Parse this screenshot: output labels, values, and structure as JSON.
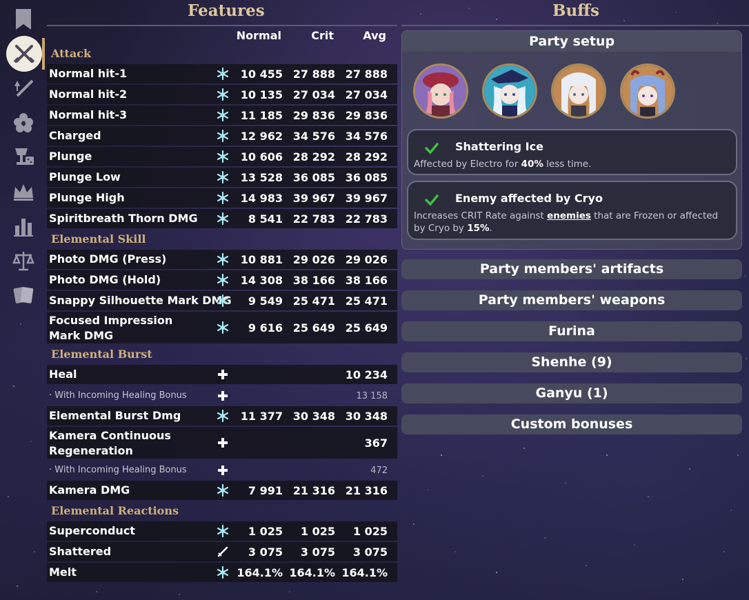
{
  "sidebar": {
    "items": [
      {
        "icon": "bookmark-icon",
        "active": false
      },
      {
        "icon": "crossed-swords-icon",
        "active": true
      },
      {
        "icon": "sword-upgrade-icon",
        "active": false
      },
      {
        "icon": "flower-icon",
        "active": false
      },
      {
        "icon": "goblet-dice-icon",
        "active": false
      },
      {
        "icon": "crown-icon",
        "active": false
      },
      {
        "icon": "bar-chart-icon",
        "active": false
      },
      {
        "icon": "scales-icon",
        "active": false
      },
      {
        "icon": "cards-icon",
        "active": false
      }
    ]
  },
  "features": {
    "title": "Features",
    "columns": [
      "Normal",
      "Crit",
      "Avg"
    ],
    "sections": [
      {
        "name": "Attack"
      },
      {
        "name": "Elemental Skill"
      },
      {
        "name": "Elemental Burst"
      },
      {
        "name": "Elemental Reactions"
      }
    ],
    "rows": [
      {
        "label": "Normal hit-1",
        "icon": "cryo-icon",
        "normal": "10 455",
        "crit": "27 888",
        "avg": "27 888"
      },
      {
        "label": "Normal hit-2",
        "icon": "cryo-icon",
        "normal": "10 135",
        "crit": "27 034",
        "avg": "27 034"
      },
      {
        "label": "Normal hit-3",
        "icon": "cryo-icon",
        "normal": "11 185",
        "crit": "29 836",
        "avg": "29 836"
      },
      {
        "label": "Charged",
        "icon": "cryo-icon",
        "normal": "12 962",
        "crit": "34 576",
        "avg": "34 576"
      },
      {
        "label": "Plunge",
        "icon": "cryo-icon",
        "normal": "10 606",
        "crit": "28 292",
        "avg": "28 292"
      },
      {
        "label": "Plunge Low",
        "icon": "cryo-icon",
        "normal": "13 528",
        "crit": "36 085",
        "avg": "36 085"
      },
      {
        "label": "Plunge High",
        "icon": "cryo-icon",
        "normal": "14 983",
        "crit": "39 967",
        "avg": "39 967"
      },
      {
        "label": "Spiritbreath Thorn DMG",
        "icon": "cryo-icon",
        "normal": "8 541",
        "crit": "22 783",
        "avg": "22 783"
      },
      {
        "label": "Photo DMG (Press)",
        "icon": "cryo-icon",
        "normal": "10 881",
        "crit": "29 026",
        "avg": "29 026"
      },
      {
        "label": "Photo DMG (Hold)",
        "icon": "cryo-icon",
        "normal": "14 308",
        "crit": "38 166",
        "avg": "38 166"
      },
      {
        "label": "Snappy Silhouette Mark DMG",
        "icon": "cryo-icon",
        "normal": "9 549",
        "crit": "25 471",
        "avg": "25 471"
      },
      {
        "label": "Focused Impression Mark DMG",
        "icon": "cryo-icon",
        "normal": "9 616",
        "crit": "25 649",
        "avg": "25 649"
      },
      {
        "label": "Heal",
        "icon": "heal-icon",
        "normal": "",
        "crit": "",
        "avg": "10 234"
      },
      {
        "label": "· With Incoming Healing Bonus",
        "icon": "heal-icon",
        "normal": "",
        "crit": "",
        "avg": "13 158"
      },
      {
        "label": "Elemental Burst Dmg",
        "icon": "cryo-icon",
        "normal": "11 377",
        "crit": "30 348",
        "avg": "30 348"
      },
      {
        "label": "Kamera Continuous Regeneration",
        "icon": "heal-icon",
        "normal": "",
        "crit": "",
        "avg": "367"
      },
      {
        "label": "· With Incoming Healing Bonus",
        "icon": "heal-icon",
        "normal": "",
        "crit": "",
        "avg": "472"
      },
      {
        "label": "Kamera DMG",
        "icon": "cryo-icon",
        "normal": "7 991",
        "crit": "21 316",
        "avg": "21 316"
      },
      {
        "label": "Superconduct",
        "icon": "cryo-icon",
        "normal": "1 025",
        "crit": "1 025",
        "avg": "1 025"
      },
      {
        "label": "Shattered",
        "icon": "sword-physical-icon",
        "normal": "3 075",
        "crit": "3 075",
        "avg": "3 075"
      },
      {
        "label": "Melt",
        "icon": "cryo-icon",
        "normal": "164.1%",
        "crit": "164.1%",
        "avg": "164.1%"
      }
    ]
  },
  "buffs": {
    "title": "Buffs",
    "party_setup": {
      "title": "Party setup",
      "avatars": [
        "pink-hair-member-avatar",
        "furina-avatar",
        "shenhe-avatar",
        "ganyu-avatar"
      ]
    },
    "cards": [
      {
        "title": "Shattering Ice",
        "desc_pre": "Affected by Electro for ",
        "desc_bold": "40%",
        "desc_post": " less time."
      },
      {
        "title": "Enemy affected by Cryo",
        "desc_pre": "Increases CRIT Rate against ",
        "desc_link": "enemies",
        "desc_mid": " that are Frozen or affected by Cryo by ",
        "desc_bold": "15%",
        "desc_post": "."
      }
    ],
    "accordions": [
      "Party members' artifacts",
      "Party members' weapons",
      "Furina",
      "Shenhe (9)",
      "Ganyu (1)",
      "Custom bonuses"
    ]
  },
  "colors": {
    "accent_gold": "#dcc79e",
    "section_gold": "#cfb07a",
    "cryo": "#a8e8f2",
    "check_green": "#3fbf3f"
  }
}
